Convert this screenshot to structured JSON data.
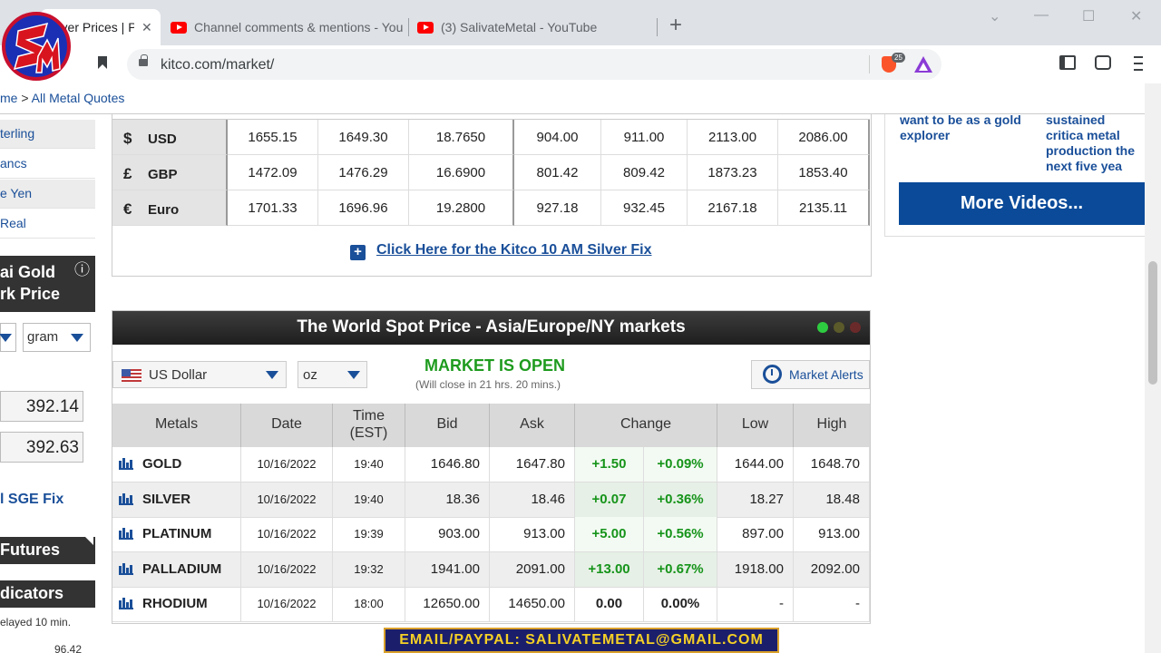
{
  "tabs": [
    {
      "label": "Silver Prices | P",
      "close": "✕"
    },
    {
      "label": "Channel comments & mentions - You"
    },
    {
      "label": "(3) SalivateMetal - YouTube"
    }
  ],
  "new_tab": "+",
  "window_controls": {
    "chevron": "⌄",
    "minimize": "—",
    "maximize": "☐",
    "close": "✕"
  },
  "url": "kitco.com/market/",
  "brave_badge": "25",
  "breadcrumb": {
    "home": "me",
    "sep": " > ",
    "current": "All Metal Quotes"
  },
  "left_column": {
    "currency_links": [
      "terling",
      "ancs",
      "e Yen",
      " Real"
    ],
    "shanghai_title_1": "ai Gold",
    "shanghai_title_2": "rk Price",
    "info_icon": "ⓘ",
    "unit_select": "gram",
    "price_1": "392.14",
    "price_2": "392.63",
    "sge_fix": "l SGE Fix",
    "futures": "Futures",
    "indicators": "dicators",
    "delayed": "elayed 10 min.",
    "bottom_value": "96.42"
  },
  "silver_fix": {
    "rows": [
      {
        "symbol": "$",
        "currency": "USD",
        "values": [
          "1655.15",
          "1649.30",
          "18.7650",
          "904.00",
          "911.00",
          "2113.00",
          "2086.00"
        ]
      },
      {
        "symbol": "£",
        "currency": "GBP",
        "values": [
          "1472.09",
          "1476.29",
          "16.6900",
          "801.42",
          "809.42",
          "1873.23",
          "1853.40"
        ]
      },
      {
        "symbol": "€",
        "currency": "Euro",
        "values": [
          "1701.33",
          "1696.96",
          "19.2800",
          "927.18",
          "932.45",
          "2167.18",
          "2135.11"
        ]
      }
    ],
    "link": "Click Here for the Kitco 10 AM Silver Fix",
    "plus": "+"
  },
  "right_column": {
    "text_1": "want to be as a gold explorer",
    "text_2": "sustained critica metal production the next five yea",
    "more_videos": "More Videos..."
  },
  "spot": {
    "title": "The World Spot Price - Asia/Europe/NY markets",
    "currency": "US Dollar",
    "unit": "oz",
    "status": "MARKET IS OPEN",
    "close_note": "(Will close in 21 hrs. 20 mins.)",
    "alerts": "Market Alerts",
    "headers": {
      "metals": "Metals",
      "date": "Date",
      "time_1": "Time",
      "time_2": "(EST)",
      "bid": "Bid",
      "ask": "Ask",
      "change": "Change",
      "low": "Low",
      "high": "High"
    },
    "rows": [
      {
        "metal": "GOLD",
        "date": "10/16/2022",
        "time": "19:40",
        "bid": "1646.80",
        "ask": "1647.80",
        "change": "+1.50",
        "pct": "+0.09%",
        "low": "1644.00",
        "high": "1648.70"
      },
      {
        "metal": "SILVER",
        "date": "10/16/2022",
        "time": "19:40",
        "bid": "18.36",
        "ask": "18.46",
        "change": "+0.07",
        "pct": "+0.36%",
        "low": "18.27",
        "high": "18.48"
      },
      {
        "metal": "PLATINUM",
        "date": "10/16/2022",
        "time": "19:39",
        "bid": "903.00",
        "ask": "913.00",
        "change": "+5.00",
        "pct": "+0.56%",
        "low": "897.00",
        "high": "913.00"
      },
      {
        "metal": "PALLADIUM",
        "date": "10/16/2022",
        "time": "19:32",
        "bid": "1941.00",
        "ask": "2091.00",
        "change": "+13.00",
        "pct": "+0.67%",
        "low": "1918.00",
        "high": "2092.00"
      },
      {
        "metal": "RHODIUM",
        "date": "10/16/2022",
        "time": "18:00",
        "bid": "12650.00",
        "ask": "14650.00",
        "change": "0.00",
        "pct": "0.00%",
        "low": "-",
        "high": "-"
      }
    ]
  },
  "email_banner": "EMAIL/PAYPAL: SALIVATEMETAL@GMAIL.COM",
  "colors": {
    "accent_blue": "#1a4f99",
    "market_open_green": "#1e9b1e",
    "header_dark": "#2b2b2b",
    "banner_bg": "#1b1f6b",
    "banner_text": "#f5d026"
  }
}
